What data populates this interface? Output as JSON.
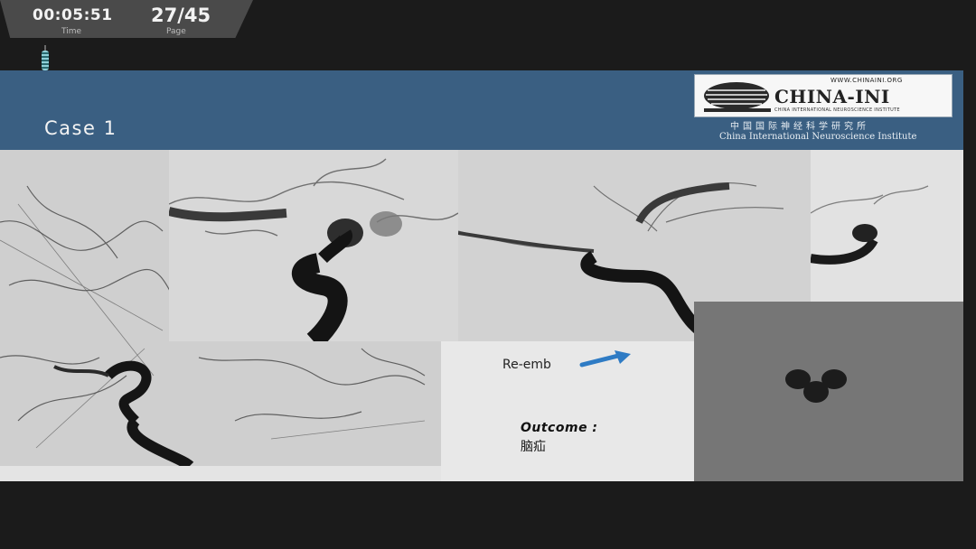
{
  "player": {
    "time": "00:05:51",
    "time_label": "Time",
    "page": "27/45",
    "page_label": "Page"
  },
  "slide": {
    "title": "Case  1",
    "logo": {
      "url": "WWW.CHINAINI.ORG",
      "name": "CHINA-INI",
      "tagline": "CHINA INTERNATIONAL NEUROSCIENCE INSTITUTE",
      "name_cn": "中国国际神经科学研究所",
      "name_en": "China International Neuroscience Institute"
    },
    "reemb_label": "Re-emb",
    "outcome_label": "Outcome :",
    "outcome_value": "脑疝"
  },
  "colors": {
    "header_bg": "#3a5f82",
    "arrow": "#2e7bc4"
  }
}
